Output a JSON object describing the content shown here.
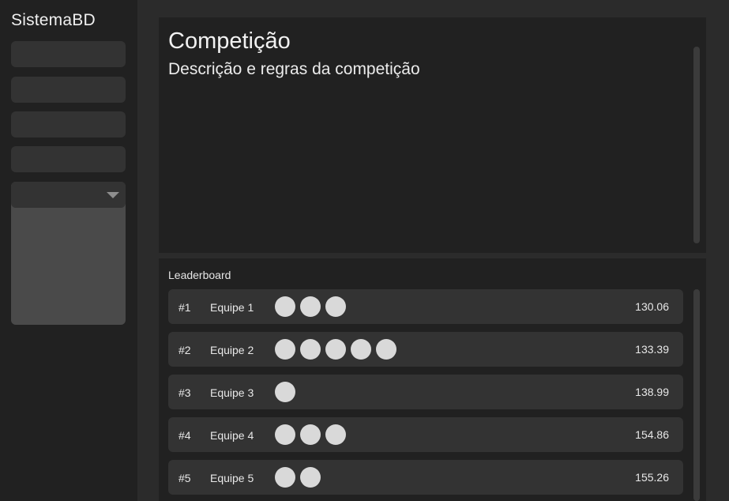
{
  "app": {
    "title": "SistemaBD"
  },
  "sidebar": {
    "items": [
      {
        "label": ""
      },
      {
        "label": ""
      },
      {
        "label": ""
      },
      {
        "label": ""
      }
    ],
    "dropdown": {
      "selected": ""
    }
  },
  "competition": {
    "title": "Competição",
    "subtitle": "Descrição e regras da competição"
  },
  "leaderboard": {
    "title": "Leaderboard",
    "rows": [
      {
        "rank": "#1",
        "team": "Equipe 1",
        "badges": 3,
        "score": "130.06"
      },
      {
        "rank": "#2",
        "team": "Equipe 2",
        "badges": 5,
        "score": "133.39"
      },
      {
        "rank": "#3",
        "team": "Equipe 3",
        "badges": 1,
        "score": "138.99"
      },
      {
        "rank": "#4",
        "team": "Equipe 4",
        "badges": 3,
        "score": "154.86"
      },
      {
        "rank": "#5",
        "team": "Equipe 5",
        "badges": 2,
        "score": "155.26"
      }
    ]
  }
}
